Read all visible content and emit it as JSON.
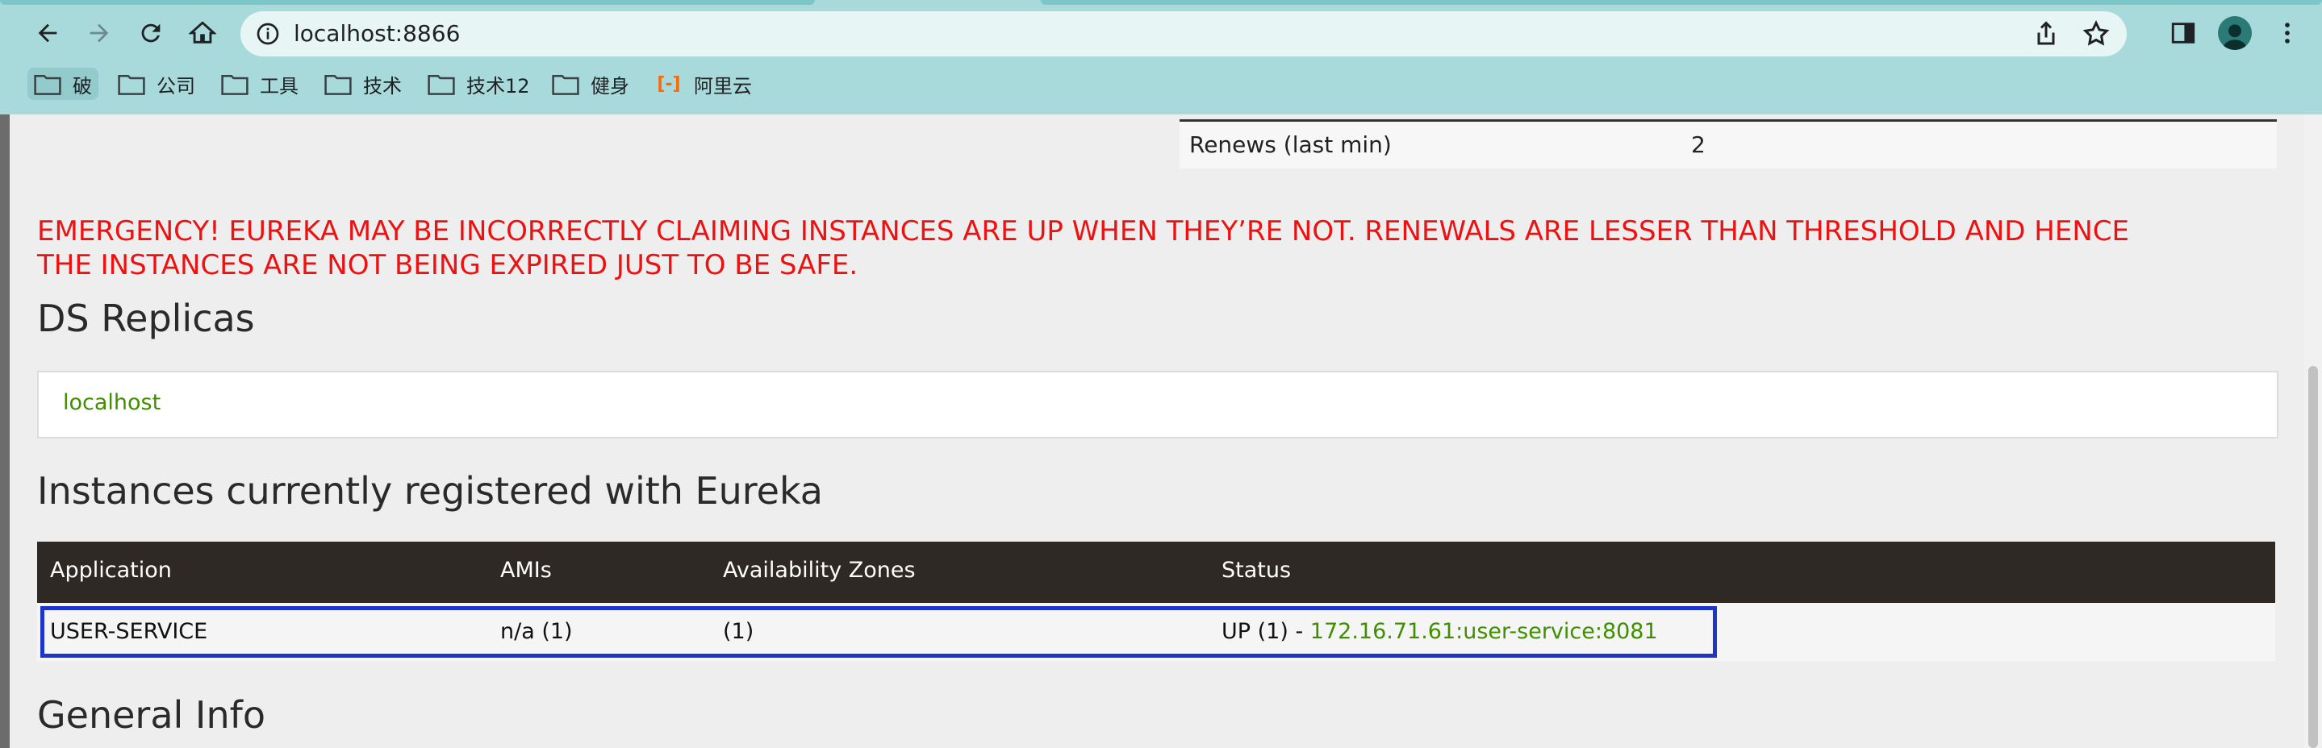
{
  "browser": {
    "url": "localhost:8866",
    "bookmarks": [
      "破",
      "公司",
      "工具",
      "技术",
      "技术12",
      "健身",
      "阿里云"
    ]
  },
  "stats": {
    "rows": [
      {
        "label": "Renews (last min)",
        "value": "2"
      }
    ]
  },
  "emergency": {
    "line1": "EMERGENCY! EUREKA MAY BE INCORRECTLY CLAIMING INSTANCES ARE UP WHEN THEY’RE NOT. RENEWALS ARE LESSER THAN THRESHOLD AND HENCE",
    "line2": "THE INSTANCES ARE NOT BEING EXPIRED JUST TO BE SAFE.",
    "color": "#ee1111"
  },
  "replicas": {
    "title": "DS Replicas",
    "items": [
      "localhost"
    ]
  },
  "instances": {
    "title": "Instances currently registered with Eureka",
    "headers": [
      "Application",
      "AMIs",
      "Availability Zones",
      "Status"
    ],
    "rows": [
      {
        "application": "USER-SERVICE",
        "amis": "n/a (1)",
        "zones": "(1)",
        "status_prefix": "UP (1) - ",
        "status_link": "172.16.71.61:user-service:8081"
      }
    ]
  },
  "general_info": {
    "title": "General Info"
  },
  "colors": {
    "link_green": "#3f8f00",
    "table_header": "#2e2925",
    "highlight_box": "#1d35c9",
    "chrome_bg": "#a8dadb"
  }
}
